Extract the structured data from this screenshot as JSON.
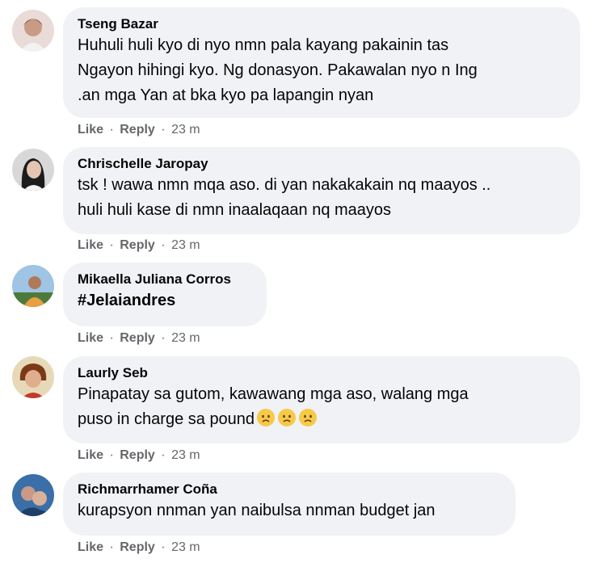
{
  "comments": [
    {
      "author": "Tseng Bazar",
      "lines": [
        "Huhuli huli kyo di nyo nmn pala kayang pakainin tas",
        "Ngayon hihingi kyo. Ng donasyon. Pakawalan nyo n Ing",
        ".an mga Yan at bka kyo pa lapangin nyan"
      ],
      "like": "Like",
      "reply": "Reply",
      "dot": "·",
      "time": "23 m"
    },
    {
      "author": "Chrischelle Jaropay",
      "lines": [
        "tsk ! wawa nmn mqa aso. di yan nakakakain nq maayos ..",
        "huli huli kase di nmn inaalaqaan nq maayos"
      ],
      "like": "Like",
      "reply": "Reply",
      "dot": "·",
      "time": "23 m"
    },
    {
      "author": "Mikaella Juliana Corros",
      "lines": [
        "#Jelaiandres"
      ],
      "like": "Like",
      "reply": "Reply",
      "dot": "·",
      "time": "23 m"
    },
    {
      "author": "Laurly Seb",
      "lines": [
        "Pinapatay sa gutom, kawawang mga aso, walang mga",
        "puso in charge sa pound"
      ],
      "emojis": [
        "sad-face-emoji",
        "sad-face-emoji",
        "sad-face-emoji"
      ],
      "like": "Like",
      "reply": "Reply",
      "dot": "·",
      "time": "23 m"
    },
    {
      "author": "Richmarrhamer Coña",
      "lines": [
        "kurapsyon nnman yan naibulsa nnman budget jan"
      ],
      "like": "Like",
      "reply": "Reply",
      "dot": "·",
      "time": "23 m"
    }
  ],
  "colors": {
    "bubble": "#f0f2f5",
    "text": "#050505",
    "meta": "#65676b"
  }
}
